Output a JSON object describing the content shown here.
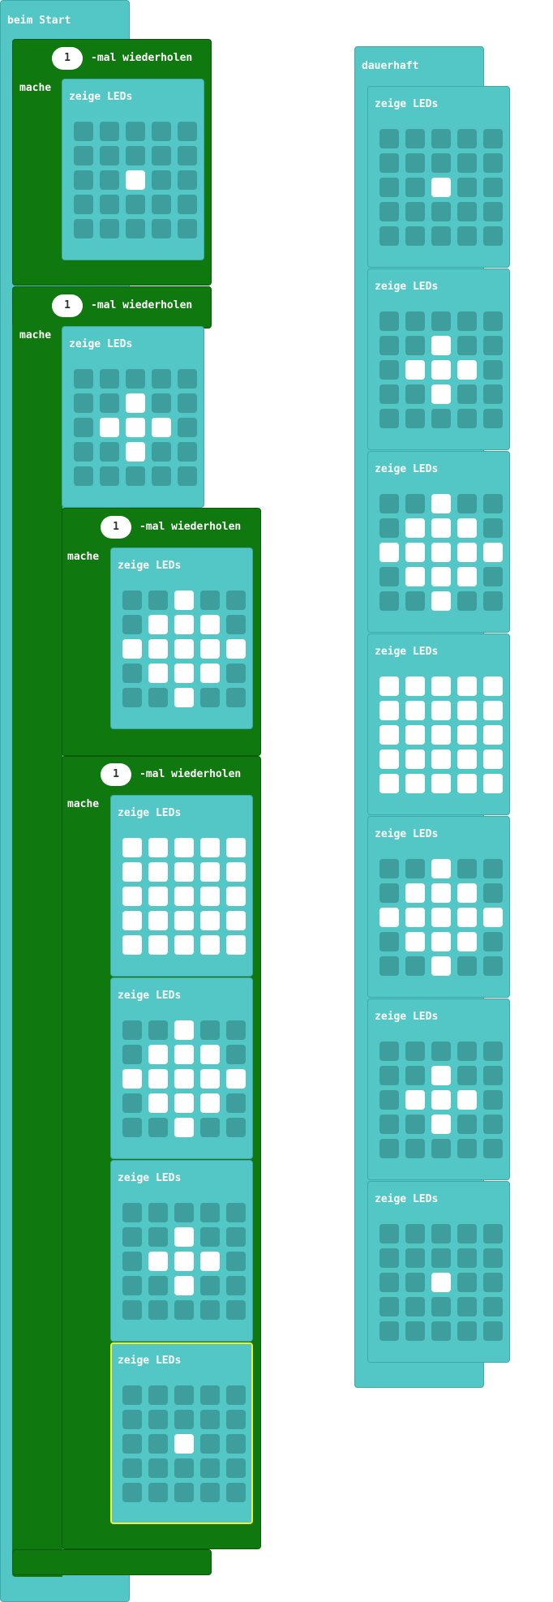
{
  "labels": {
    "start": "beim Start",
    "forever": "dauerhaft",
    "repeat_suffix": "-mal wiederholen",
    "do": "mache",
    "show_leds": "zeige LEDs"
  },
  "colors": {
    "event": "#52c7c6",
    "loop": "#0f780f",
    "led_off": "#3e9e9e",
    "led_on": "#ffffff",
    "selection": "#f2f233"
  },
  "loops": [
    {
      "times": "1"
    },
    {
      "times": "1"
    },
    {
      "times": "1"
    },
    {
      "times": "1"
    }
  ],
  "patterns": {
    "dot": [
      "00000",
      "00000",
      "00100",
      "00000",
      "00000"
    ],
    "plus": [
      "00000",
      "00100",
      "01110",
      "00100",
      "00000"
    ],
    "diamond": [
      "00100",
      "01110",
      "11111",
      "01110",
      "00100"
    ],
    "full": [
      "11111",
      "11111",
      "11111",
      "11111",
      "11111"
    ]
  },
  "start_show_blocks": [
    "dot",
    "plus",
    "diamond",
    "full",
    "diamond",
    "plus",
    "dot"
  ],
  "forever_show_blocks": [
    "dot",
    "plus",
    "diamond",
    "full",
    "diamond",
    "plus",
    "dot"
  ]
}
